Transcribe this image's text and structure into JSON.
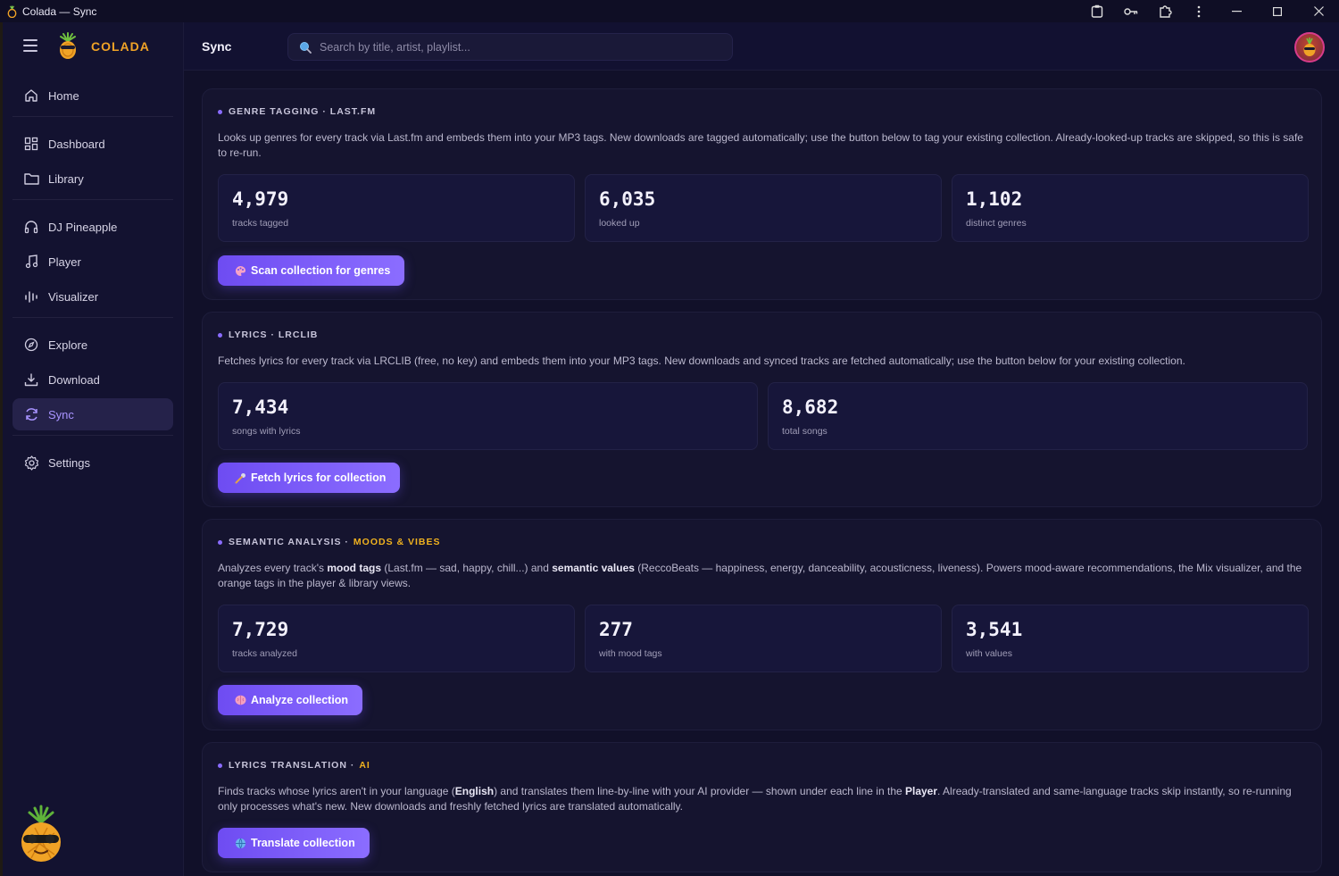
{
  "window": {
    "title": "Colada — Sync"
  },
  "brand": {
    "name": "COLADA"
  },
  "header": {
    "title": "Sync",
    "search_placeholder": "Search by title, artist, playlist..."
  },
  "sidebar": {
    "items": [
      {
        "label": "Home",
        "icon": "home-icon"
      },
      {
        "label": "Dashboard",
        "icon": "dashboard-icon"
      },
      {
        "label": "Library",
        "icon": "folder-icon"
      },
      {
        "label": "DJ Pineapple",
        "icon": "headphones-icon"
      },
      {
        "label": "Player",
        "icon": "music-note-icon"
      },
      {
        "label": "Visualizer",
        "icon": "equalizer-icon"
      },
      {
        "label": "Explore",
        "icon": "compass-icon"
      },
      {
        "label": "Download",
        "icon": "download-icon"
      },
      {
        "label": "Sync",
        "icon": "sync-icon",
        "active": true
      },
      {
        "label": "Settings",
        "icon": "gear-icon"
      }
    ]
  },
  "cards": {
    "genre": {
      "title": "GENRE TAGGING · LAST.FM",
      "desc": "Looks up genres for every track via Last.fm and embeds them into your MP3 tags. New downloads are tagged automatically; use the button below to tag your existing collection. Already-looked-up tracks are skipped, so this is safe to re-run.",
      "stats": [
        {
          "value": "4,979",
          "label": "tracks tagged"
        },
        {
          "value": "6,035",
          "label": "looked up"
        },
        {
          "value": "1,102",
          "label": "distinct genres"
        }
      ],
      "button": "Scan collection for genres"
    },
    "lyrics": {
      "title": "LYRICS · LRCLIB",
      "desc": "Fetches lyrics for every track via LRCLIB (free, no key) and embeds them into your MP3 tags. New downloads and synced tracks are fetched automatically; use the button below for your existing collection.",
      "stats": [
        {
          "value": "7,434",
          "label": "songs with lyrics"
        },
        {
          "value": "8,682",
          "label": "total songs"
        }
      ],
      "button": "Fetch lyrics for collection"
    },
    "semantic": {
      "title": "SEMANTIC ANALYSIS ·",
      "accent": "MOODS & VIBES",
      "desc_parts": [
        "Analyzes every track's ",
        "mood tags",
        " (Last.fm — sad, happy, chill...) and ",
        "semantic values",
        " (ReccoBeats — happiness, energy, danceability, acousticness, liveness). Powers mood-aware recommendations, the Mix visualizer, and the orange tags in the player & library views."
      ],
      "stats": [
        {
          "value": "7,729",
          "label": "tracks analyzed"
        },
        {
          "value": "277",
          "label": "with mood tags"
        },
        {
          "value": "3,541",
          "label": "with values"
        }
      ],
      "button": "Analyze collection"
    },
    "translation": {
      "title": "LYRICS TRANSLATION ·",
      "accent": "AI",
      "desc_parts": [
        "Finds tracks whose lyrics aren't in your language (",
        "English",
        ") and translates them line-by-line with your AI provider — shown under each line in the ",
        "Player",
        ". Already-translated and same-language tracks skip instantly, so re-running only processes what's new. New downloads and freshly fetched lyrics are translated automatically."
      ],
      "button": "Translate collection"
    }
  },
  "colors": {
    "accent": "#8b6dff",
    "brand": "#f0a326",
    "background": "#111029"
  }
}
